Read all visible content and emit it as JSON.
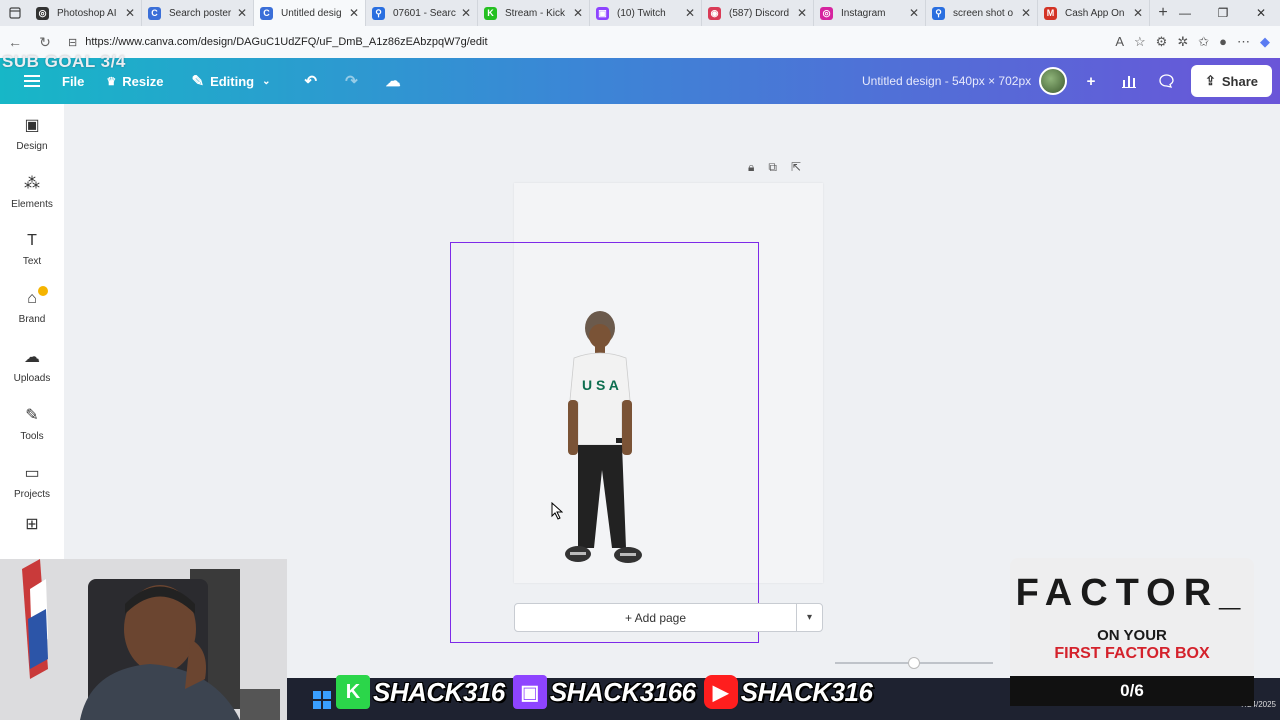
{
  "browser": {
    "tabs": [
      {
        "label": "Photoshop AI",
        "fav_color": "#333333",
        "fav_glyph": "◎",
        "active": false
      },
      {
        "label": "Search poster",
        "fav_color": "#3b6fd8",
        "fav_glyph": "C",
        "active": false
      },
      {
        "label": "Untitled desig",
        "fav_color": "#3b6fd8",
        "fav_glyph": "C",
        "active": true
      },
      {
        "label": "07601 - Searc",
        "fav_color": "#2a6fe0",
        "fav_glyph": "⚲",
        "active": false
      },
      {
        "label": "Stream - Kick",
        "fav_color": "#25c021",
        "fav_glyph": "K",
        "active": false
      },
      {
        "label": "(10) Twitch",
        "fav_color": "#8e44ff",
        "fav_glyph": "▣",
        "active": false
      },
      {
        "label": "(587) Discord",
        "fav_color": "#d93b57",
        "fav_glyph": "◉",
        "active": false
      },
      {
        "label": "Instagram",
        "fav_color": "#d6249f",
        "fav_glyph": "◎",
        "active": false
      },
      {
        "label": "screen shot o",
        "fav_color": "#2a6fe0",
        "fav_glyph": "⚲",
        "active": false
      },
      {
        "label": "Cash App On",
        "fav_color": "#d33426",
        "fav_glyph": "M",
        "active": false
      }
    ],
    "url": "https://www.canva.com/design/DAGuC1UdZFQ/uF_DmB_A1z86zEAbzpqW7g/edit"
  },
  "overlay_top": {
    "subgoal": "SUB GOAL 3/4"
  },
  "canva_bar": {
    "menu_icon": "hamburger-icon",
    "file": "File",
    "resize": "Resize",
    "editing": "Editing",
    "design_title": "Untitled design - 540px × 702px",
    "share": "Share"
  },
  "sidebar": {
    "items": [
      {
        "label": "Design",
        "icon": "▣"
      },
      {
        "label": "Elements",
        "icon": "⁂"
      },
      {
        "label": "Text",
        "icon": "T"
      },
      {
        "label": "Brand",
        "icon": "⌂"
      },
      {
        "label": "Uploads",
        "icon": "☁"
      },
      {
        "label": "Tools",
        "icon": "✎"
      },
      {
        "label": "Projects",
        "icon": "▭"
      },
      {
        "label": "Apps",
        "icon": "⊞"
      }
    ]
  },
  "canvas": {
    "add_page": "+ Add page",
    "selection_color": "#7d2ae8"
  },
  "factor": {
    "title": "FACTOR_",
    "line1": "ON YOUR",
    "line2": "FIRST FACTOR BOX",
    "count": "0/6"
  },
  "social": {
    "kick": "SHACK316",
    "twitch": "SHACK3166",
    "youtube": "SHACK316"
  },
  "clock": {
    "date": "7/24/2025"
  }
}
